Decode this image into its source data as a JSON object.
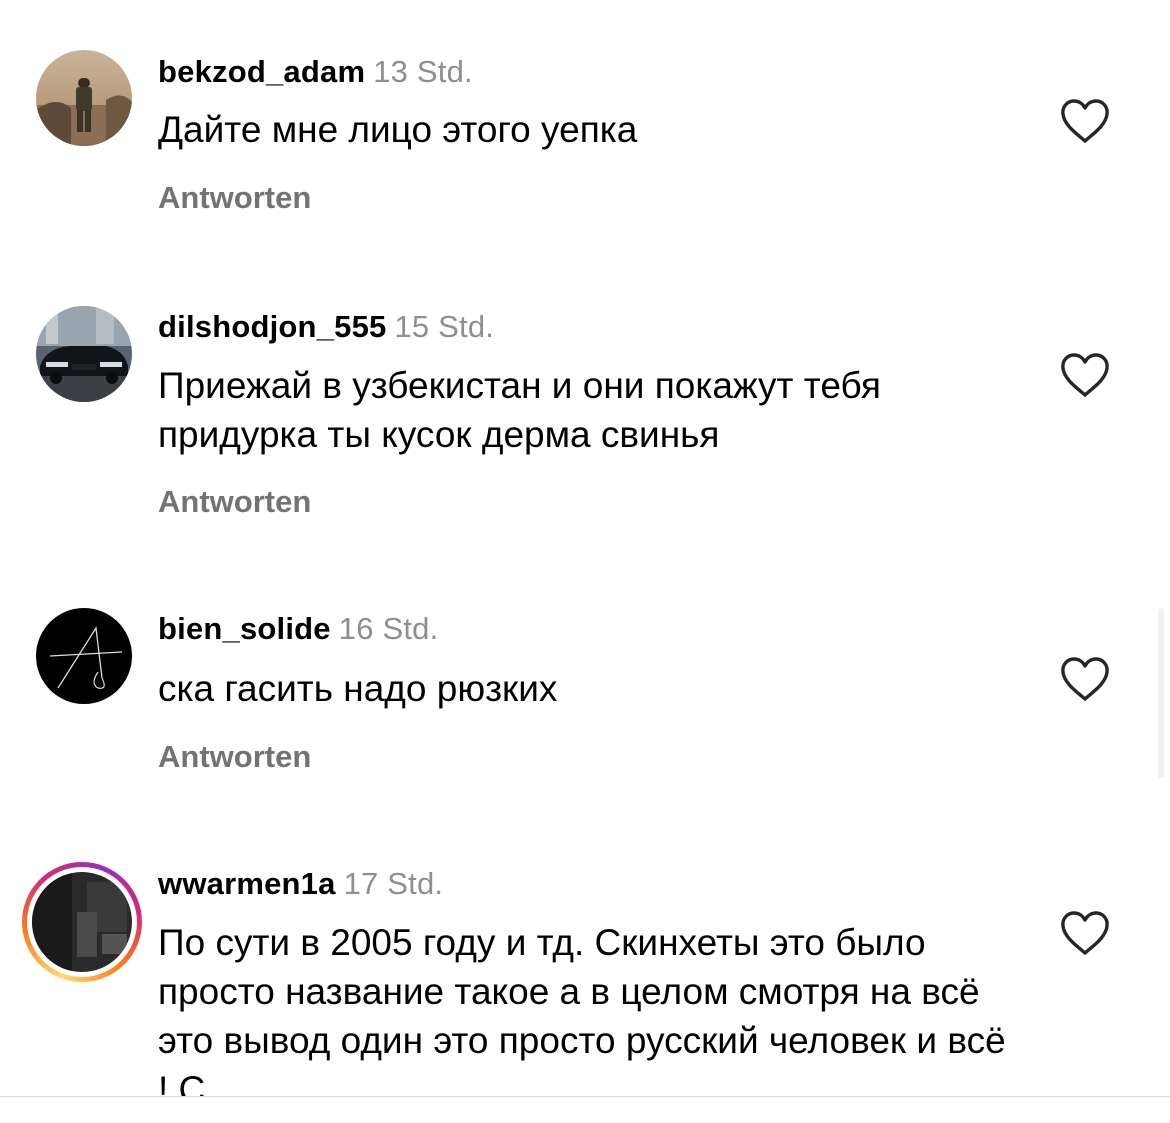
{
  "reply_label": "Antworten",
  "comments": [
    {
      "username": "bekzod_adam",
      "time": "13 Std.",
      "text": "Дайте мне лицо этого уепка"
    },
    {
      "username": "dilshodjon_555",
      "time": "15 Std.",
      "text": "Приежай в узбекистан и они покажут тебя придурка ты кусок дерма свинья"
    },
    {
      "username": "bien_solide",
      "time": "16 Std.",
      "text": "ска гасить надо рюзких"
    },
    {
      "username": "wwarmen1a",
      "time": "17 Std.",
      "text": "По сути в 2005 году и тд. Скинхеты это было просто название такое  а в целом смотря на всё  это  вывод один это просто русский человек  и всё !  С"
    }
  ],
  "icons": {
    "like": "heart-outline-icon",
    "story_ring": "story-ring"
  },
  "colors": {
    "username": "#000000",
    "timestamp": "#8e8e8e",
    "reply": "#737373",
    "heart": "#262626"
  }
}
